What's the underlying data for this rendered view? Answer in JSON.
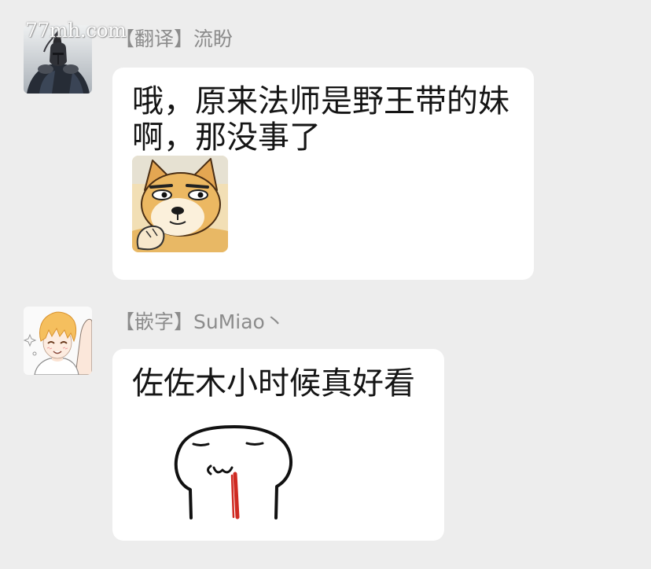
{
  "watermark": "77mh.com",
  "colors": {
    "page_background": "#ededed",
    "bubble_background": "#ffffff",
    "sender_name": "#8c8c8c",
    "message_text": "#151515",
    "watermark": "#ffffff",
    "nosebleed": "#cf2a22"
  },
  "messages": [
    {
      "sender": "【翻译】流盼",
      "avatar_icon": "knight-portrait-icon",
      "lines": [
        "哦，原来法师是野王带的妹",
        "啊，那没事了"
      ],
      "sticker_icon": "doge-sticker-icon"
    },
    {
      "sender": "【嵌字】SuMiao丶",
      "avatar_icon": "anime-boy-portrait-icon",
      "lines": [
        "佐佐木小时候真好看"
      ],
      "sticker_icon": "nosebleed-blob-sticker-icon"
    }
  ]
}
